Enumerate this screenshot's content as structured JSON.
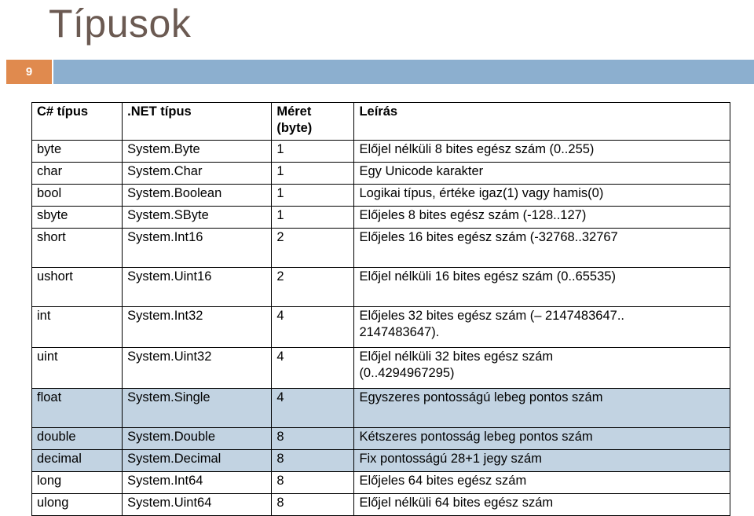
{
  "slide": {
    "title": "Típusok",
    "number": "9"
  },
  "colors": {
    "title": "#6b5a52",
    "badge_orange": "#e08a4e",
    "band_blue": "#8cafcf",
    "row_shaded": "#c2d3e2"
  },
  "table": {
    "headers": {
      "cs_type": "C# típus",
      "net_type": ".NET típus",
      "size": "Méret",
      "size_unit": "(byte)",
      "description": "Leírás"
    },
    "rows": [
      {
        "cs": "byte",
        "net": "System.Byte",
        "size": "1",
        "desc": "Előjel nélküli 8 bites egész szám (0..255)",
        "desc2": "",
        "shaded": false
      },
      {
        "cs": "char",
        "net": "System.Char",
        "size": "1",
        "desc": "Egy Unicode karakter",
        "desc2": "",
        "shaded": false
      },
      {
        "cs": "bool",
        "net": "System.Boolean",
        "size": "1",
        "desc": "Logikai típus, értéke igaz(1) vagy hamis(0)",
        "desc2": "",
        "shaded": false
      },
      {
        "cs": "sbyte",
        "net": "System.SByte",
        "size": "1",
        "desc": "Előjeles 8 bites egész szám (-128..127)",
        "desc2": "",
        "shaded": false
      },
      {
        "cs": "short",
        "net": "System.Int16",
        "size": "2",
        "desc": "Előjeles 16 bites egész szám (-32768..32767",
        "desc2": "",
        "shaded": false
      },
      {
        "cs": "ushort",
        "net": "System.Uint16",
        "size": "2",
        "desc": "Előjel nélküli 16 bites egész szám (0..65535)",
        "desc2": "",
        "shaded": false
      },
      {
        "cs": "int",
        "net": "System.Int32",
        "size": "4",
        "desc": "Előjeles 32 bites egész szám (– 2147483647..",
        "desc2": "2147483647).",
        "shaded": false
      },
      {
        "cs": "uint",
        "net": "System.Uint32",
        "size": "4",
        "desc": "Előjel nélküli 32 bites egész szám",
        "desc2": "(0..4294967295)",
        "shaded": false
      },
      {
        "cs": "float",
        "net": "System.Single",
        "size": "4",
        "desc": "Egyszeres pontosságú lebeg pontos szám",
        "desc2": "",
        "shaded": true
      },
      {
        "cs": "double",
        "net": "System.Double",
        "size": "8",
        "desc": "Kétszeres pontosság lebeg pontos szám",
        "desc2": "",
        "shaded": true
      },
      {
        "cs": "decimal",
        "net": "System.Decimal",
        "size": "8",
        "desc": "Fix pontosságú 28+1 jegy  szám",
        "desc2": "",
        "shaded": true
      },
      {
        "cs": "long",
        "net": "System.Int64",
        "size": "8",
        "desc": "Előjeles 64 bites egész szám",
        "desc2": "",
        "shaded": false
      },
      {
        "cs": "ulong",
        "net": "System.Uint64",
        "size": "8",
        "desc": "Előjel nélküli 64 bites egész szám",
        "desc2": "",
        "shaded": false
      }
    ]
  }
}
